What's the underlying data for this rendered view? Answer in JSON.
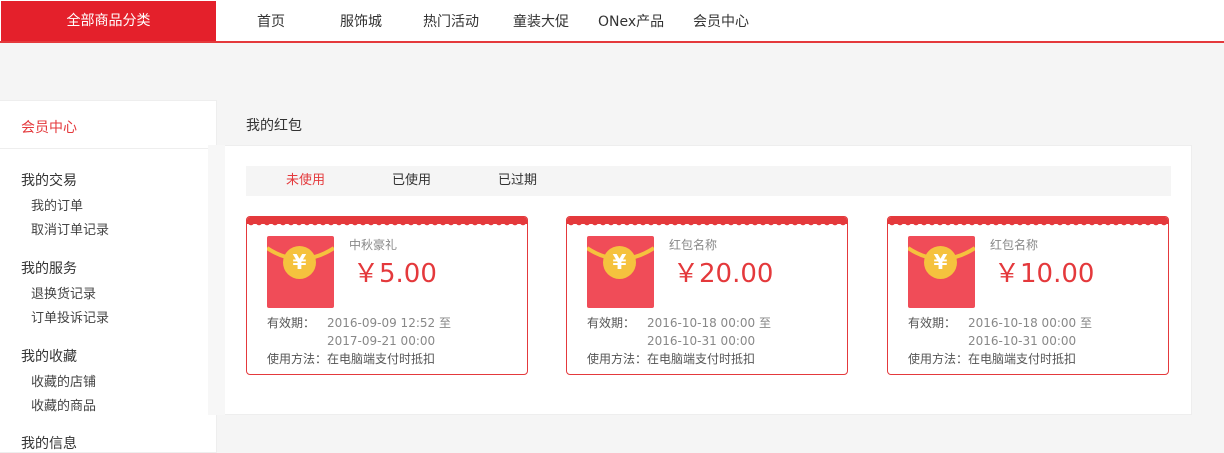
{
  "topnav": {
    "category_button": "全部商品分类",
    "items": [
      "首页",
      "服饰城",
      "热门活动",
      "童装大促",
      "ONex产品",
      "会员中心"
    ]
  },
  "sidebar": {
    "header": "会员中心",
    "groups": [
      {
        "title": "我的交易",
        "links": [
          "我的订单",
          "取消订单记录"
        ]
      },
      {
        "title": "我的服务",
        "links": [
          "退换货记录",
          "订单投诉记录"
        ]
      },
      {
        "title": "我的收藏",
        "links": [
          "收藏的店铺",
          "收藏的商品"
        ]
      },
      {
        "title": "我的信息",
        "links": []
      }
    ]
  },
  "main": {
    "title": "我的红包",
    "tabs": [
      {
        "label": "未使用",
        "active": true
      },
      {
        "label": "已使用",
        "active": false
      },
      {
        "label": "已过期",
        "active": false
      }
    ],
    "validity_label": "有效期：",
    "coupons": [
      {
        "name": "中秋豪礼",
        "amount": "￥5.00",
        "valid_from": "2016-09-09 12:52 至",
        "valid_to": "2017-09-21 00:00",
        "usage": "使用方法：在电脑端支付时抵扣"
      },
      {
        "name": "红包名称",
        "amount": "￥20.00",
        "valid_from": "2016-10-18 00:00 至",
        "valid_to": "2016-10-31 00:00",
        "usage": "使用方法：在电脑端支付时抵扣"
      },
      {
        "name": "红包名称",
        "amount": "￥10.00",
        "valid_from": "2016-10-18 00:00 至",
        "valid_to": "2016-10-31 00:00",
        "usage": "使用方法：在电脑端支付时抵扣"
      }
    ]
  },
  "icons": {
    "envelope": "red-envelope-icon",
    "coin": "yuan-coin-icon"
  },
  "colors": {
    "accent": "#e4393c",
    "envelope": "#f04c58",
    "coin": "#f5c23e"
  }
}
